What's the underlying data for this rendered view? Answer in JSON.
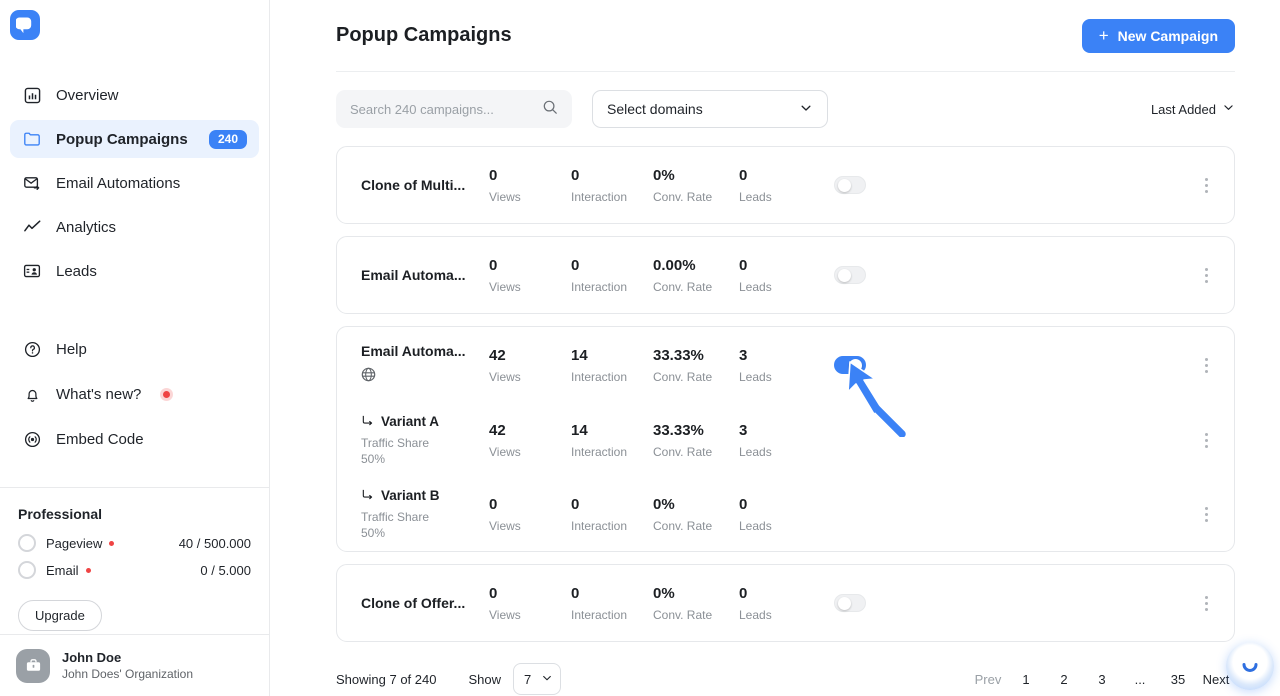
{
  "sidebar": {
    "logo_name": "popupsmart-logo",
    "nav_main": [
      {
        "label": "Overview",
        "icon": "chart-square-icon",
        "active": false
      },
      {
        "label": "Popup Campaigns",
        "icon": "folder-icon",
        "active": true,
        "badge": "240"
      },
      {
        "label": "Email Automations",
        "icon": "envelope-arrow-icon",
        "active": false
      },
      {
        "label": "Analytics",
        "icon": "line-chart-icon",
        "active": false
      },
      {
        "label": "Leads",
        "icon": "contact-card-icon",
        "active": false
      }
    ],
    "nav_secondary": [
      {
        "label": "Help",
        "icon": "question-circle-icon",
        "dot": false
      },
      {
        "label": "What's new?",
        "icon": "bell-icon",
        "dot": true
      },
      {
        "label": "Embed Code",
        "icon": "broadcast-icon",
        "dot": false
      }
    ],
    "plan": {
      "title": "Professional",
      "quotas": [
        {
          "name": "Pageview",
          "value": "40 / 500.000"
        },
        {
          "name": "Email",
          "value": "0 / 5.000"
        }
      ],
      "upgrade_label": "Upgrade"
    },
    "user": {
      "name": "John Doe",
      "org": "John Does' Organization",
      "avatar_icon": "briefcase-icon"
    }
  },
  "header": {
    "title": "Popup Campaigns",
    "new_campaign_label": "New Campaign",
    "new_campaign_plus": "+"
  },
  "filters": {
    "search_placeholder": "Search 240 campaigns...",
    "search_value": "",
    "domain_select_label": "Select domains",
    "sort_label": "Last Added"
  },
  "stat_labels": {
    "views": "Views",
    "interaction": "Interaction",
    "conv_rate": "Conv. Rate",
    "leads": "Leads"
  },
  "campaigns": [
    {
      "name": "Clone of Multi...",
      "views": "0",
      "interaction": "0",
      "conv_rate": "0%",
      "leads": "0",
      "enabled": false,
      "has_globe": false,
      "variants": []
    },
    {
      "name": "Email Automa...",
      "views": "0",
      "interaction": "0",
      "conv_rate": "0.00%",
      "leads": "0",
      "enabled": false,
      "has_globe": false,
      "variants": []
    },
    {
      "name": "Email Automa...",
      "views": "42",
      "interaction": "14",
      "conv_rate": "33.33%",
      "leads": "3",
      "enabled": true,
      "has_globe": true,
      "variants": [
        {
          "name": "Variant A",
          "traffic_label": "Traffic Share",
          "traffic_value": "50%",
          "views": "42",
          "interaction": "14",
          "conv_rate": "33.33%",
          "leads": "3"
        },
        {
          "name": "Variant B",
          "traffic_label": "Traffic Share",
          "traffic_value": "50%",
          "views": "0",
          "interaction": "0",
          "conv_rate": "0%",
          "leads": "0"
        }
      ]
    },
    {
      "name": "Clone of Offer...",
      "views": "0",
      "interaction": "0",
      "conv_rate": "0%",
      "leads": "0",
      "enabled": false,
      "has_globe": false,
      "variants": []
    }
  ],
  "footer": {
    "showing": "Showing 7 of 240",
    "show_label": "Show",
    "show_value": "7",
    "pager": [
      {
        "label": "Prev",
        "muted": true
      },
      {
        "label": "1",
        "muted": false
      },
      {
        "label": "2",
        "muted": false
      },
      {
        "label": "3",
        "muted": false
      },
      {
        "label": "...",
        "muted": false
      },
      {
        "label": "35",
        "muted": false
      },
      {
        "label": "Next",
        "muted": false
      }
    ]
  },
  "colors": {
    "accent": "#3b82f6",
    "accent_soft": "#eaf2fe",
    "danger": "#ef4444",
    "text": "#1c1f23",
    "muted": "#8b9096"
  },
  "chat_widget": {
    "icon": "chat-smile-icon"
  },
  "cursor": {
    "icon": "mouse-arrow-cursor"
  }
}
